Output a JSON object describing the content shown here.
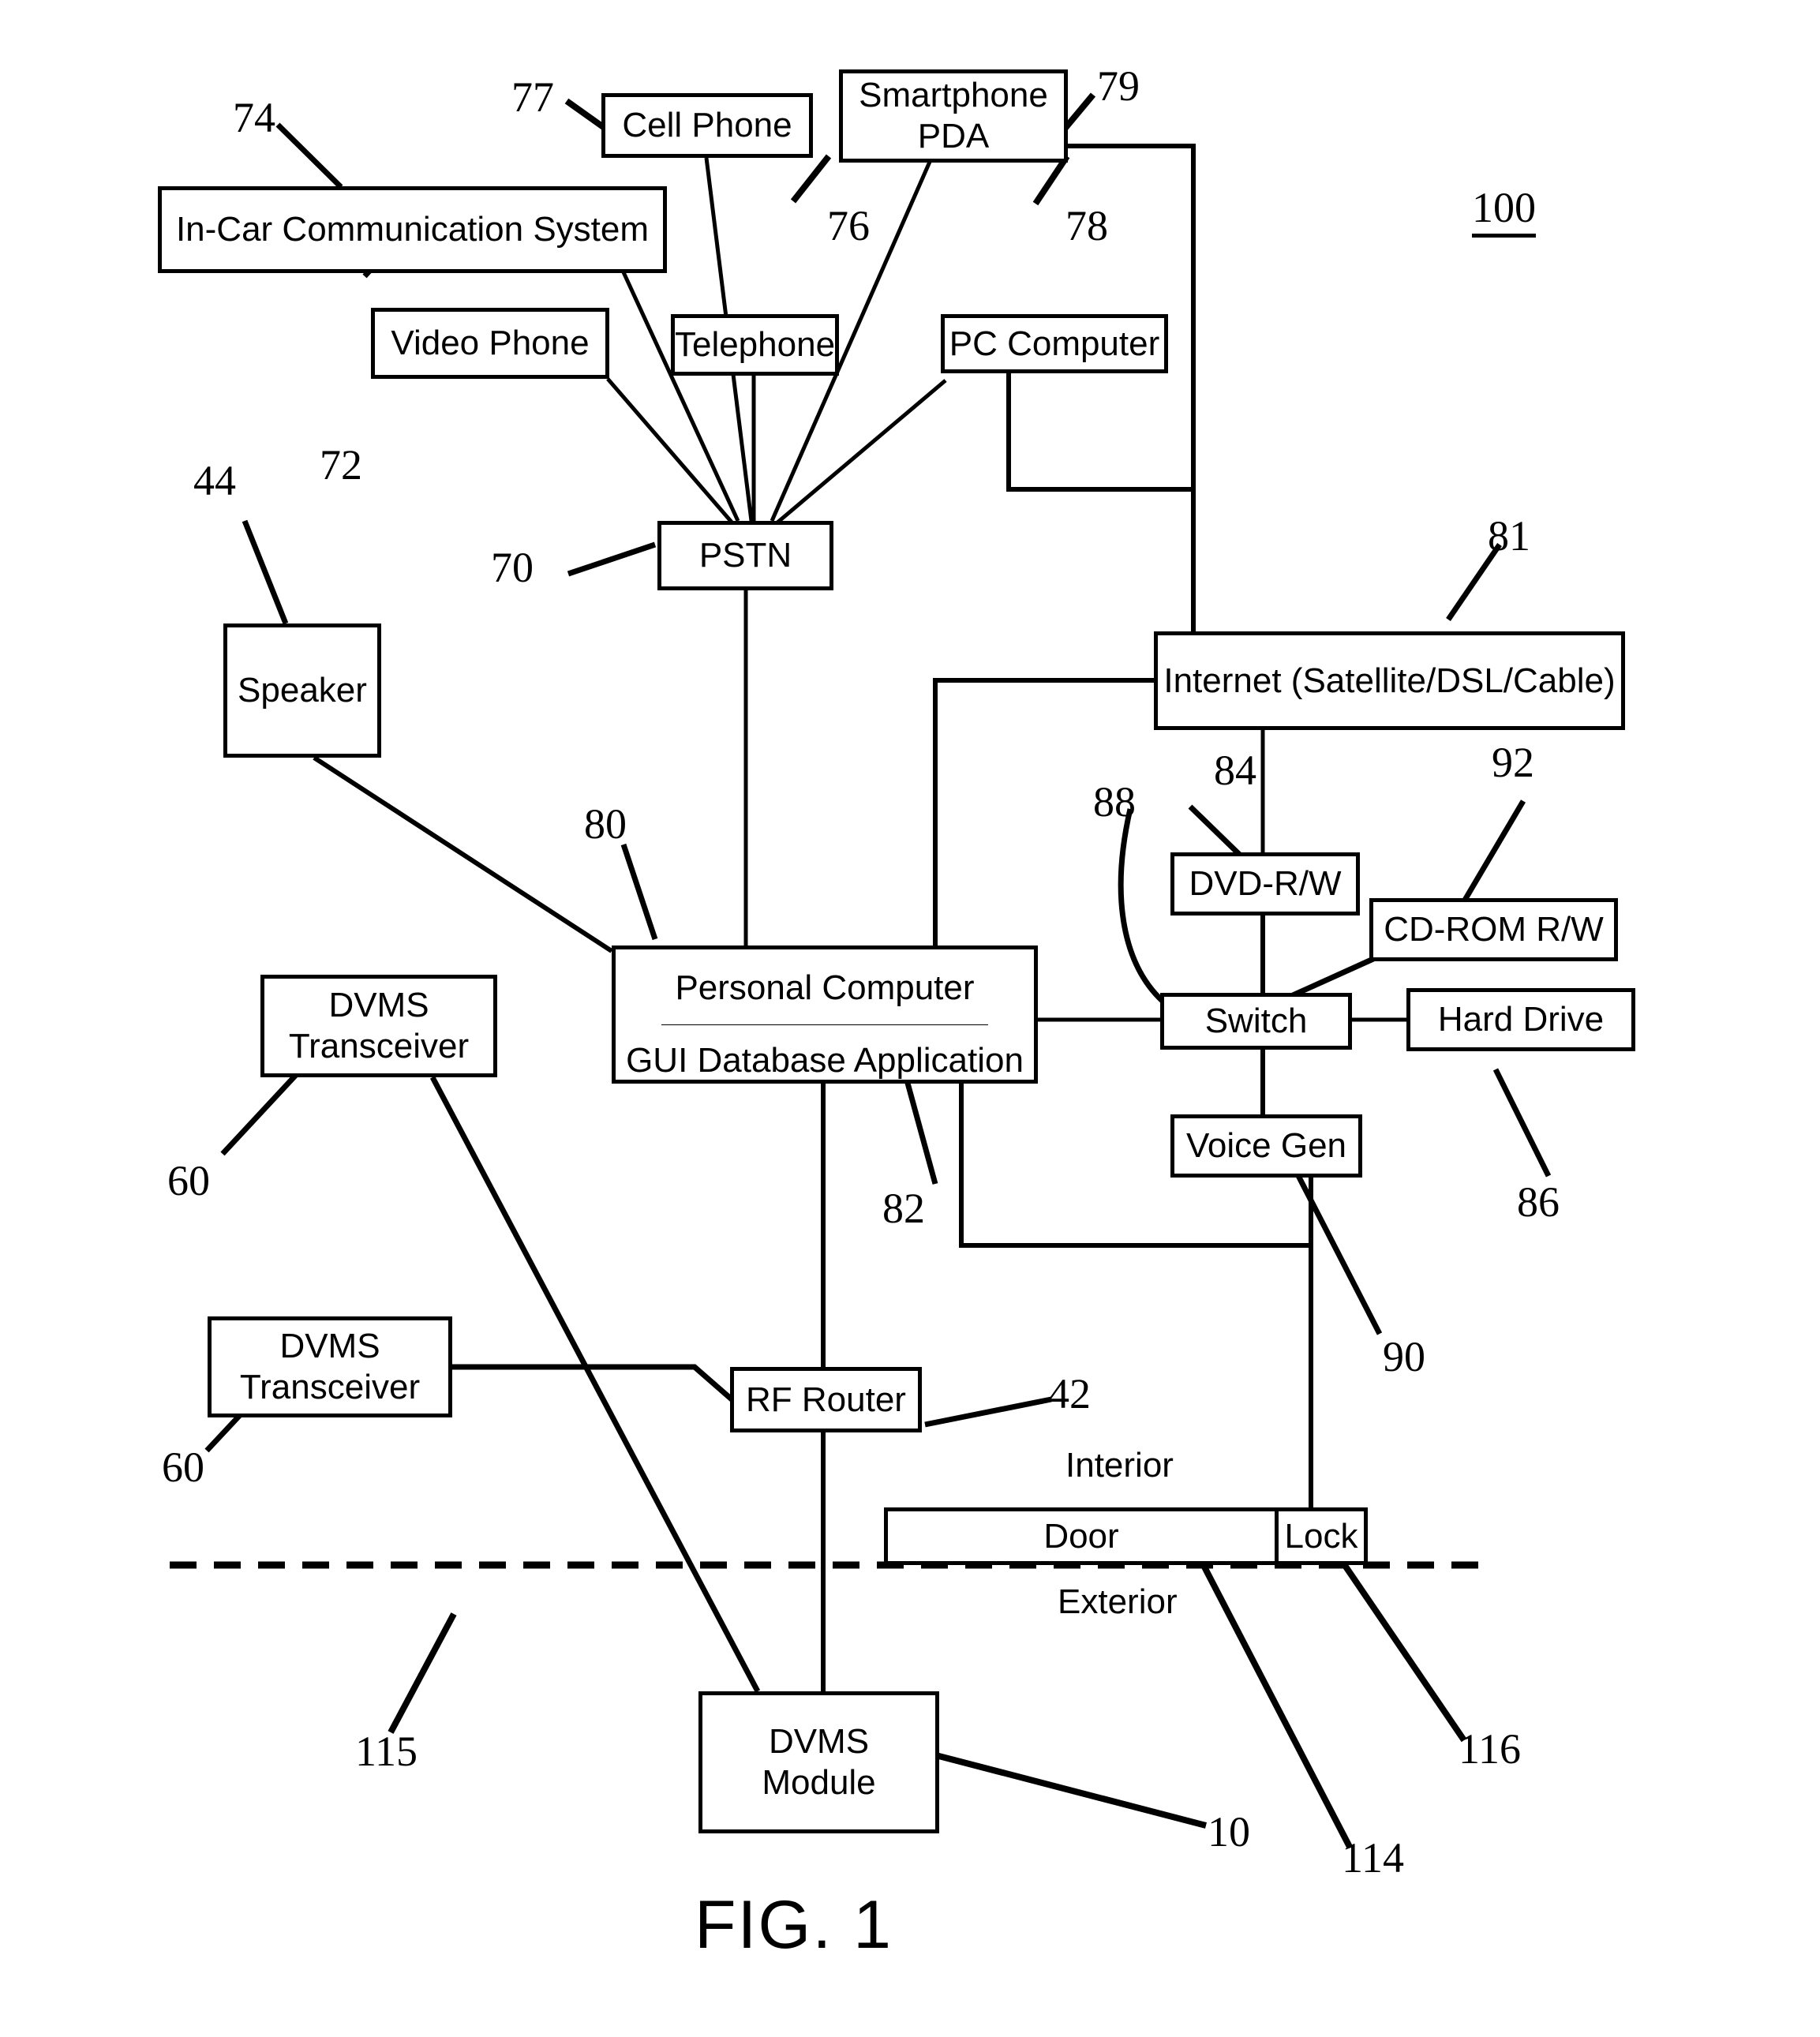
{
  "figure": {
    "caption": "FIG. 1",
    "system_ref": "100"
  },
  "nodes": {
    "in_car": {
      "label": "In-Car Communication System",
      "ref": "74"
    },
    "cell_phone": {
      "label": "Cell Phone",
      "ref": "77"
    },
    "smartphone_pda": {
      "line1": "Smartphone",
      "line2": "PDA",
      "ref": "79"
    },
    "video_phone": {
      "label": "Video Phone",
      "ref": "72"
    },
    "telephone": {
      "label": "Telephone",
      "ref": "76"
    },
    "pc_computer": {
      "label": "PC Computer",
      "ref": "78"
    },
    "pstn": {
      "label": "PSTN",
      "ref": "70"
    },
    "internet": {
      "label": "Internet (Satellite/DSL/Cable)",
      "ref": "81"
    },
    "speaker": {
      "label": "Speaker",
      "ref": "44"
    },
    "personal_computer": {
      "line1": "Personal Computer",
      "line2": "GUI Database Application",
      "ref_top": "80",
      "ref_bottom": "82"
    },
    "dvms_transceiver_upper": {
      "line1": "DVMS",
      "line2": "Transceiver",
      "ref": "60"
    },
    "dvms_transceiver_lower": {
      "line1": "DVMS",
      "line2": "Transceiver",
      "ref": "60"
    },
    "rf_router": {
      "label": "RF Router",
      "ref": "42"
    },
    "dvms_module": {
      "line1": "DVMS",
      "line2": "Module",
      "ref": "10"
    },
    "dvd_rw": {
      "label": "DVD-R/W",
      "ref": "84"
    },
    "cd_rom_rw": {
      "label": "CD-ROM R/W",
      "ref": "92"
    },
    "switch": {
      "label": "Switch",
      "ref": "88"
    },
    "hard_drive": {
      "label": "Hard Drive",
      "ref": "86"
    },
    "voice_gen": {
      "label": "Voice Gen",
      "ref": "90"
    },
    "door": {
      "label": "Door",
      "ref": "114"
    },
    "lock": {
      "label": "Lock",
      "ref": "116"
    }
  },
  "labels": {
    "interior": "Interior",
    "exterior": "Exterior",
    "boundary_ref": "115"
  },
  "colors": {
    "line": "#000000",
    "background": "#ffffff"
  }
}
